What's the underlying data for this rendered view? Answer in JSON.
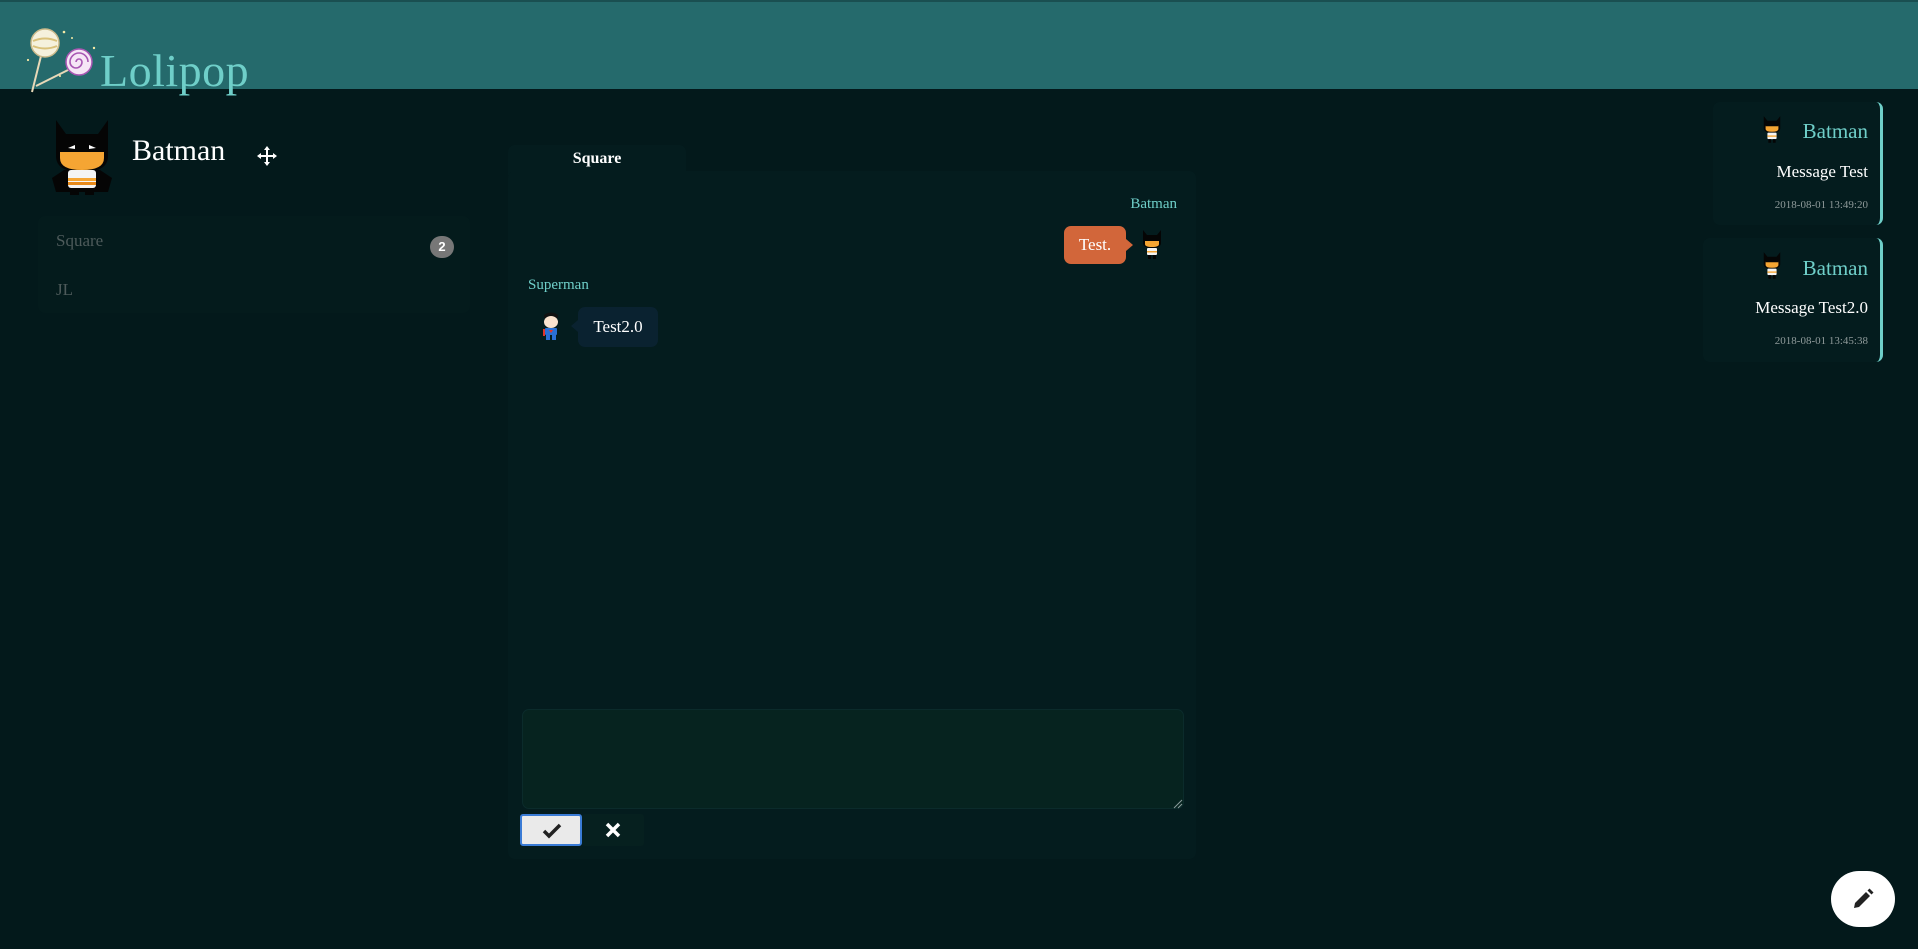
{
  "app": {
    "title": "Lolipop"
  },
  "colors": {
    "header": "#256a6c",
    "background": "#03191b",
    "accent": "#6fcfc9",
    "outgoing_bubble": "#d2663a",
    "incoming_bubble": "#0a2230"
  },
  "user": {
    "name": "Batman",
    "avatar": "batman-avatar-icon"
  },
  "rooms": [
    {
      "label": "Square",
      "badge": "2"
    },
    {
      "label": "JL",
      "badge": ""
    }
  ],
  "chat": {
    "tab_label": "Square",
    "messages": [
      {
        "sender": "Batman",
        "text": "Test.",
        "direction": "outgoing"
      },
      {
        "sender": "Superman",
        "text": "Test2.0",
        "direction": "incoming"
      }
    ],
    "composer": {
      "value": "",
      "placeholder": ""
    },
    "buttons": {
      "confirm": "check-icon",
      "cancel": "times-icon"
    }
  },
  "notifications": [
    {
      "sender": "Batman",
      "message": "Message Test",
      "time": "2018-08-01 13:49:20"
    },
    {
      "sender": "Batman",
      "message": "Message Test2.0",
      "time": "2018-08-01 13:45:38"
    }
  ],
  "fab": {
    "icon": "pencil-icon"
  }
}
